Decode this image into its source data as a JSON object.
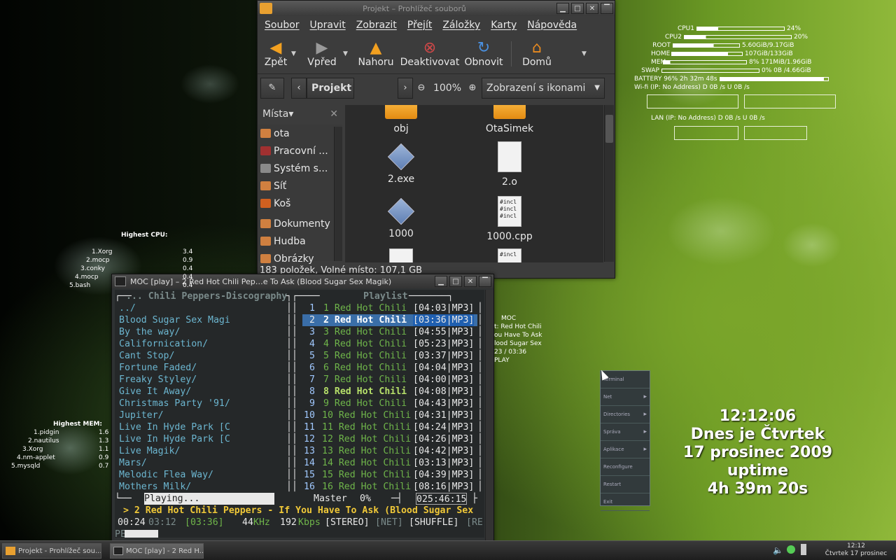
{
  "file_manager": {
    "title": "Projekt – Prohlížeč souborů",
    "menu": [
      "Soubor",
      "Upravit",
      "Zobrazit",
      "Přejít",
      "Záložky",
      "Karty",
      "Nápověda"
    ],
    "toolbar": {
      "back": "Zpět",
      "forward": "Vpřed",
      "up": "Nahoru",
      "stop": "Deaktivovat",
      "reload": "Obnovit",
      "home": "Domů"
    },
    "location": "Projekt",
    "zoom": "100%",
    "view_mode": "Zobrazení s ikonami",
    "places_label": "Místa",
    "places": [
      "ota",
      "Pracovní ...",
      "Systém s...",
      "Síť",
      "Koš",
      "Dokumenty",
      "Hudba",
      "Obrázky"
    ],
    "files": [
      {
        "name": "obj",
        "kind": "folder"
      },
      {
        "name": "OtaSimek",
        "kind": "folder"
      },
      {
        "name": "2.exe",
        "kind": "exe"
      },
      {
        "name": "2.o",
        "kind": "doc"
      },
      {
        "name": "1000",
        "kind": "exe"
      },
      {
        "name": "1000.cpp",
        "kind": "code"
      }
    ],
    "code_preview": "#incl",
    "status": "183 položek, Volné místo: 107,1 GB"
  },
  "moc": {
    "title": "MOC [play] – 2 Red Hot Chili Pep…e To Ask (Blood Sugar Sex Magik)",
    "dir_header": "... Chili Peppers-Discography",
    "playlist_header": "Playlist",
    "dirs": [
      "../",
      "Blood Sugar Sex Magi",
      "By the way/",
      "Californication/",
      "Cant Stop/",
      "Fortune Faded/",
      "Freaky Styley/",
      "Give It Away/",
      "Christmas Party '91/",
      "Jupiter/",
      "Live In Hyde Park [C",
      "Live In Hyde Park [C",
      "Live Magik/",
      "Mars/",
      "Melodic Flea Way/",
      "Mothers Milk/"
    ],
    "tracks": [
      {
        "n": "1",
        "name": "1 Red Hot Chili",
        "time": "[04:03|MP3]"
      },
      {
        "n": "2",
        "name": "2 Red Hot Chili",
        "time": "[03:36|MP3]"
      },
      {
        "n": "3",
        "name": "3 Red Hot Chili",
        "time": "[04:55|MP3]"
      },
      {
        "n": "4",
        "name": "4 Red Hot Chili",
        "time": "[05:23|MP3]"
      },
      {
        "n": "5",
        "name": "5 Red Hot Chili",
        "time": "[03:37|MP3]"
      },
      {
        "n": "6",
        "name": "6 Red Hot Chili",
        "time": "[04:04|MP3]"
      },
      {
        "n": "7",
        "name": "7 Red Hot Chili",
        "time": "[04:00|MP3]"
      },
      {
        "n": "8",
        "name": "8 Red Hot Chili",
        "time": "[04:08|MP3]"
      },
      {
        "n": "9",
        "name": "9 Red Hot Chili",
        "time": "[04:43|MP3]"
      },
      {
        "n": "10",
        "name": "10 Red Hot Chili",
        "time": "[04:31|MP3]"
      },
      {
        "n": "11",
        "name": "11 Red Hot Chili",
        "time": "[04:24|MP3]"
      },
      {
        "n": "12",
        "name": "12 Red Hot Chili",
        "time": "[04:26|MP3]"
      },
      {
        "n": "13",
        "name": "13 Red Hot Chili",
        "time": "[04:42|MP3]"
      },
      {
        "n": "14",
        "name": "14 Red Hot Chili",
        "time": "[03:13|MP3]"
      },
      {
        "n": "15",
        "name": "15 Red Hot Chili",
        "time": "[04:39|MP3]"
      },
      {
        "n": "16",
        "name": "16 Red Hot Chili",
        "time": "[08:16|MP3]"
      }
    ],
    "state": "Playing...",
    "mixer": "Master",
    "volume": "0%",
    "total_time": "025:46:15",
    "now_playing": "> 2 Red Hot Chili Peppers - If You Have To Ask (Blood Sugar Sex",
    "elapsed": "00:24",
    "remaining": "03:12",
    "length": "[03:36]",
    "freq": "44",
    "freq_unit": "KHz",
    "bitrate": "192",
    "bitrate_unit": "Kbps",
    "stereo": "[STEREO]",
    "net": "[NET]",
    "shuffle": "[SHUFFLE]",
    "re": "[RE",
    "prompt": "PE"
  },
  "conky": {
    "cpu1": {
      "label": "CPU1",
      "value": "24%",
      "fill": 0.24
    },
    "cpu2": {
      "label": "CPU2",
      "value": "20%",
      "fill": 0.2
    },
    "root": {
      "label": "ROOT",
      "value": "5.60GiB/9.17GiB",
      "fill": 0.61
    },
    "home": {
      "label": "HOME",
      "value": "107GiB/133GiB",
      "fill": 0.8
    },
    "mem": {
      "label": "MEM:",
      "value": "8% 171MiB/1.96GiB",
      "fill": 0.08
    },
    "swap": {
      "label": "SWAP",
      "value": "0% 0B  /4.66GiB",
      "fill": 0.0
    },
    "battery": {
      "label": "BATTERY 96% 2h 32m 48s",
      "fill": 0.96
    },
    "wifi": "Wi-fi       (IP: No Address)   D 0B  /s U     0B  /s",
    "lan": "LAN (IP: No Address)         D 0B  /s U     0B  /s",
    "cpu_title": "Highest CPU:",
    "cpu_procs": [
      [
        "1.Xorg",
        "3.4"
      ],
      [
        "2.mocp",
        "0.9"
      ],
      [
        "3.conky",
        "0.4"
      ],
      [
        "4.mocp",
        "0.4"
      ],
      [
        "5.bash",
        "0.4"
      ]
    ],
    "mem_title": "Highest MEM:",
    "mem_procs": [
      [
        "1.pidgin",
        "1.6"
      ],
      [
        "2.nautilus",
        "1.3"
      ],
      [
        "3.Xorg",
        "1.1"
      ],
      [
        "4.nm-applet",
        "0.9"
      ],
      [
        "5.mysqld",
        "0.7"
      ]
    ],
    "moc_lines": [
      "MOC",
      "t: Red Hot Chili",
      "ou Have To Ask",
      "lood Sugar Sex",
      "23 / 03:36",
      "PLAY"
    ]
  },
  "desktop_menu": [
    "Terminal",
    "Net",
    "Directories",
    "Správa",
    "Aplikace",
    "Reconfigure",
    "Restart",
    "Exit"
  ],
  "clock": {
    "time": "12:12:06",
    "day": "Dnes je Čtvrtek",
    "date": "17 prosinec 2009",
    "uptime_label": "uptime",
    "uptime": "4h 39m 20s"
  },
  "taskbar": {
    "tasks": [
      "Projekt - Prohlížeč sou...",
      "MOC [play] - 2 Red H..."
    ],
    "time": "12:12",
    "date": "Čtvrtek 17 prosinec"
  }
}
